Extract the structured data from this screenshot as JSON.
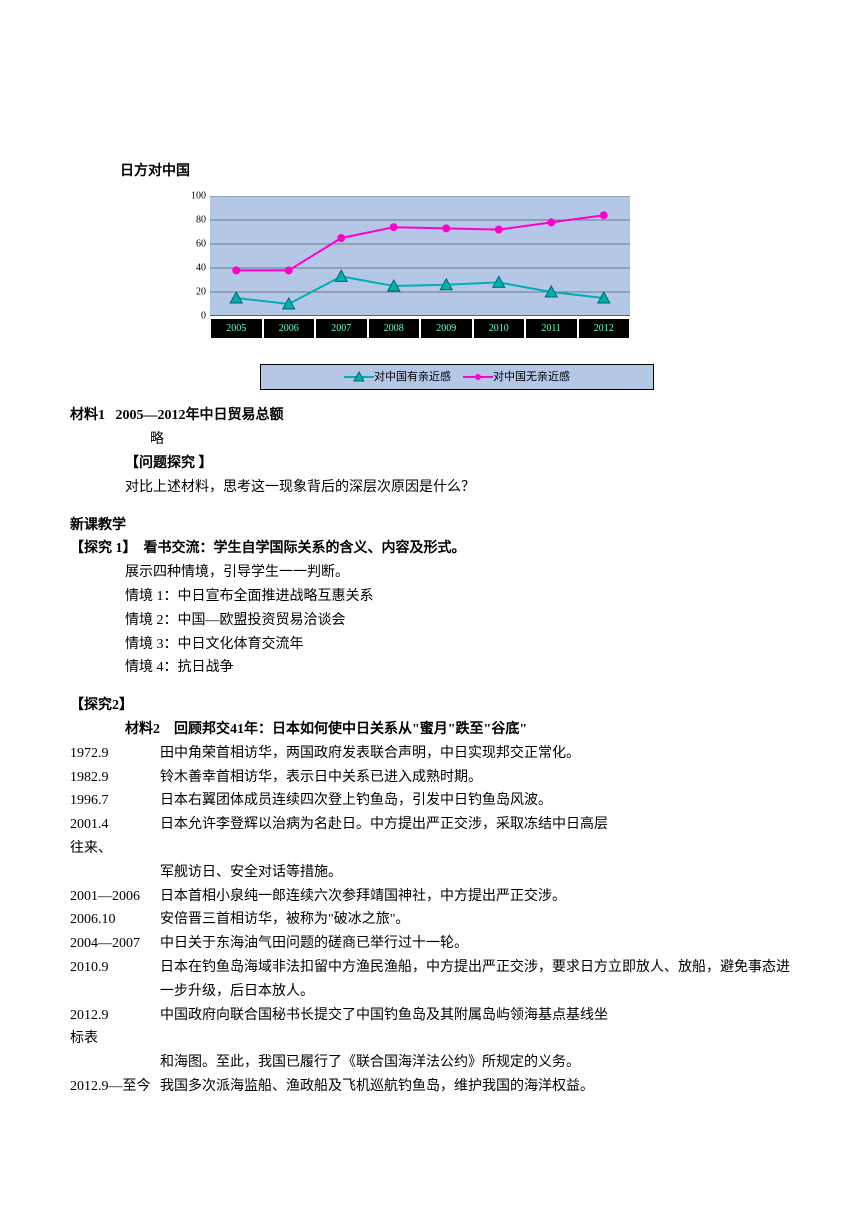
{
  "chart_title": "日方对中国",
  "chart_data": {
    "type": "line",
    "categories": [
      "2005",
      "2006",
      "2007",
      "2008",
      "2009",
      "2010",
      "2011",
      "2012"
    ],
    "series": [
      {
        "name": "对中国有亲近感",
        "marker": "triangle",
        "color": "#00B0B0",
        "values": [
          15,
          10,
          33,
          25,
          26,
          28,
          20,
          15
        ]
      },
      {
        "name": "对中国无亲近感",
        "marker": "dot",
        "color": "#FF00CC",
        "values": [
          38,
          38,
          65,
          74,
          73,
          72,
          78,
          84
        ]
      }
    ],
    "ylim": [
      0,
      100
    ],
    "yticks": [
      0,
      20,
      40,
      60,
      80,
      100
    ]
  },
  "material1": {
    "label": "材料1",
    "title": "2005—2012年中日贸易总额",
    "detail": "略"
  },
  "inquiry_label": "【问题探究 】",
  "inquiry_q": "对比上述材料，思考这一现象背后的深层次原因是什么？",
  "teaching_header": "新课教学",
  "explore1": {
    "label": "【探究 1】",
    "title": "看书交流：学生自学国际关系的含义、内容及形式。",
    "lead": "展示四种情境，引导学生一一判断。",
    "situ": [
      "情境 1：中日宣布全面推进战略互惠关系",
      "情境 2：中国—欧盟投资贸易洽谈会",
      "情境 3：中日文化体育交流年",
      "情境 4：抗日战争"
    ]
  },
  "explore2": {
    "label": "【探究2】",
    "material": {
      "label": "材料2",
      "title": "回顾邦交41年：日本如何使中日关系从\"蜜月\"跌至\"谷底\""
    },
    "rows": [
      {
        "date": "1972.9",
        "text": "田中角荣首相访华，两国政府发表联合声明，中日实现邦交正常化。"
      },
      {
        "date": "1982.9",
        "text": "铃木善幸首相访华，表示日中关系已进入成熟时期。"
      },
      {
        "date": "1996.7",
        "text": "日本右翼团体成员连续四次登上钓鱼岛，引发中日钓鱼岛风波。"
      },
      {
        "date": "2001.4",
        "text": "日本允许李登辉以治病为名赴日。中方提出严正交涉，采取冻结中日高层",
        "wrap": "往来、",
        "cont": "军舰访日、安全对话等措施。"
      },
      {
        "date": "2001—2006",
        "text": "日本首相小泉纯一郎连续六次参拜靖国神社，中方提出严正交涉。"
      },
      {
        "date": "2006.10",
        "text": "安倍晋三首相访华，被称为\"破冰之旅\"。"
      },
      {
        "date": "2004—2007",
        "text": "中日关于东海油气田问题的磋商已举行过十一轮。"
      },
      {
        "date": "2010.9",
        "text": "日本在钓鱼岛海域非法扣留中方渔民渔船，中方提出严正交涉，要求日方立即放人、放船，避免事态进一步升级，后日本放人。"
      },
      {
        "date": "2012.9",
        "text": "中国政府向联合国秘书长提交了中国钓鱼岛及其附属岛屿领海基点基线坐",
        "wrap": "标表",
        "cont": "和海图。至此，我国已履行了《联合国海洋法公约》所规定的义务。"
      },
      {
        "date": "2012.9—至今",
        "text": "我国多次派海监船、渔政船及飞机巡航钓鱼岛，维护我国的海洋权益。"
      }
    ]
  }
}
